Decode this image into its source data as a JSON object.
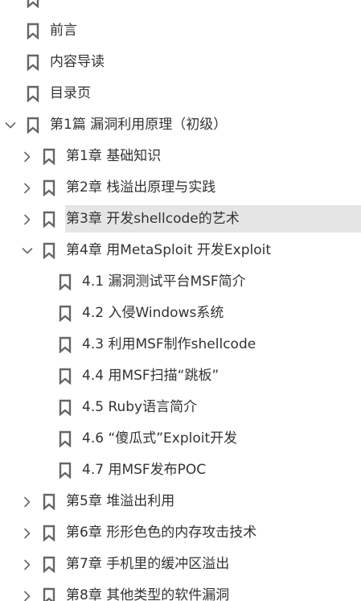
{
  "icons": {
    "bookmark": "bookmark-icon",
    "collapsed": "chevron-right-icon",
    "expanded": "chevron-down-icon"
  },
  "colors": {
    "text": "#333333",
    "icon": "#666666",
    "selected_background": "#e5e5e5"
  },
  "toc": [
    {
      "label": "",
      "level": 0,
      "toggle": "none"
    },
    {
      "label": "前言",
      "level": 0,
      "toggle": "none"
    },
    {
      "label": "内容导读",
      "level": 0,
      "toggle": "none"
    },
    {
      "label": "目录页",
      "level": 0,
      "toggle": "none"
    },
    {
      "label": "第1篇  漏洞利用原理（初级）",
      "level": 0,
      "toggle": "expanded"
    },
    {
      "label": "第1章  基础知识",
      "level": 1,
      "toggle": "collapsed"
    },
    {
      "label": "第2章  栈溢出原理与实践",
      "level": 1,
      "toggle": "collapsed"
    },
    {
      "label": "第3章  开发shellcode的艺术",
      "level": 1,
      "toggle": "collapsed",
      "selected": true
    },
    {
      "label": "第4章  用MetaSploit 开发Exploit",
      "level": 1,
      "toggle": "expanded"
    },
    {
      "label": "4.1  漏洞测试平台MSF简介",
      "level": 2,
      "toggle": "none"
    },
    {
      "label": "4.2  入侵Windows系统",
      "level": 2,
      "toggle": "none"
    },
    {
      "label": "4.3  利用MSF制作shellcode",
      "level": 2,
      "toggle": "none"
    },
    {
      "label": "4.4  用MSF扫描“跳板”",
      "level": 2,
      "toggle": "none"
    },
    {
      "label": "4.5  Ruby语言简介",
      "level": 2,
      "toggle": "none"
    },
    {
      "label": "4.6  “傻瓜式”Exploit开发",
      "level": 2,
      "toggle": "none"
    },
    {
      "label": "4.7  用MSF发布POC",
      "level": 2,
      "toggle": "none"
    },
    {
      "label": "第5章  堆溢出利用",
      "level": 1,
      "toggle": "collapsed"
    },
    {
      "label": "第6章  形形色色的内存攻击技术",
      "level": 1,
      "toggle": "collapsed"
    },
    {
      "label": "第7章  手机里的缓冲区溢出",
      "level": 1,
      "toggle": "collapsed"
    },
    {
      "label": "第8章  其他类型的软件漏洞",
      "level": 1,
      "toggle": "collapsed"
    }
  ]
}
